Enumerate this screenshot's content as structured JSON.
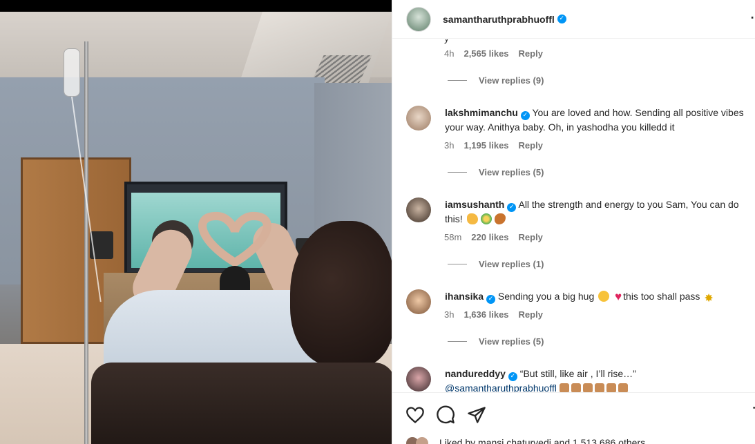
{
  "post": {
    "username": "samantharuthprabhuoffl",
    "more_icon": "more-options-icon"
  },
  "comments": [
    {
      "id": "c0",
      "partial": true,
      "time": "4h",
      "likes": "2,565 likes",
      "reply": "Reply",
      "view_replies": "View replies (9)"
    },
    {
      "id": "c1",
      "username": "lakshmimanchu",
      "text": "You are loved and how. Sending all positive vibes your way. Anithya baby. Oh, in yashodha you killedd it",
      "time": "3h",
      "likes": "1,195 likes",
      "reply": "Reply",
      "view_replies": "View replies (5)"
    },
    {
      "id": "c2",
      "username": "iamsushanth",
      "text": "All the strength and energy to you Sam, You can do this!",
      "time": "58m",
      "likes": "220 likes",
      "reply": "Reply",
      "view_replies": "View replies (1)"
    },
    {
      "id": "c3",
      "username": "ihansika",
      "text_a": "Sending you a big hug",
      "text_b": "this too shall pass",
      "time": "3h",
      "likes": "1,636 likes",
      "reply": "Reply",
      "view_replies": "View replies (5)"
    },
    {
      "id": "c4",
      "username": "nandureddyy",
      "text": "“But still, like air , I’ll rise…”",
      "mention": "@samantharuthprabhuoffl"
    }
  ],
  "actions": {
    "like_icon": "heart-icon",
    "comment_icon": "comment-icon",
    "share_icon": "share-icon",
    "save_icon": "bookmark-icon"
  },
  "liked_by": "Liked by mansi.chaturvedi and 1,513,686 others",
  "colors": {
    "verified": "#0095f6",
    "link": "#00376b",
    "muted": "#737373"
  }
}
